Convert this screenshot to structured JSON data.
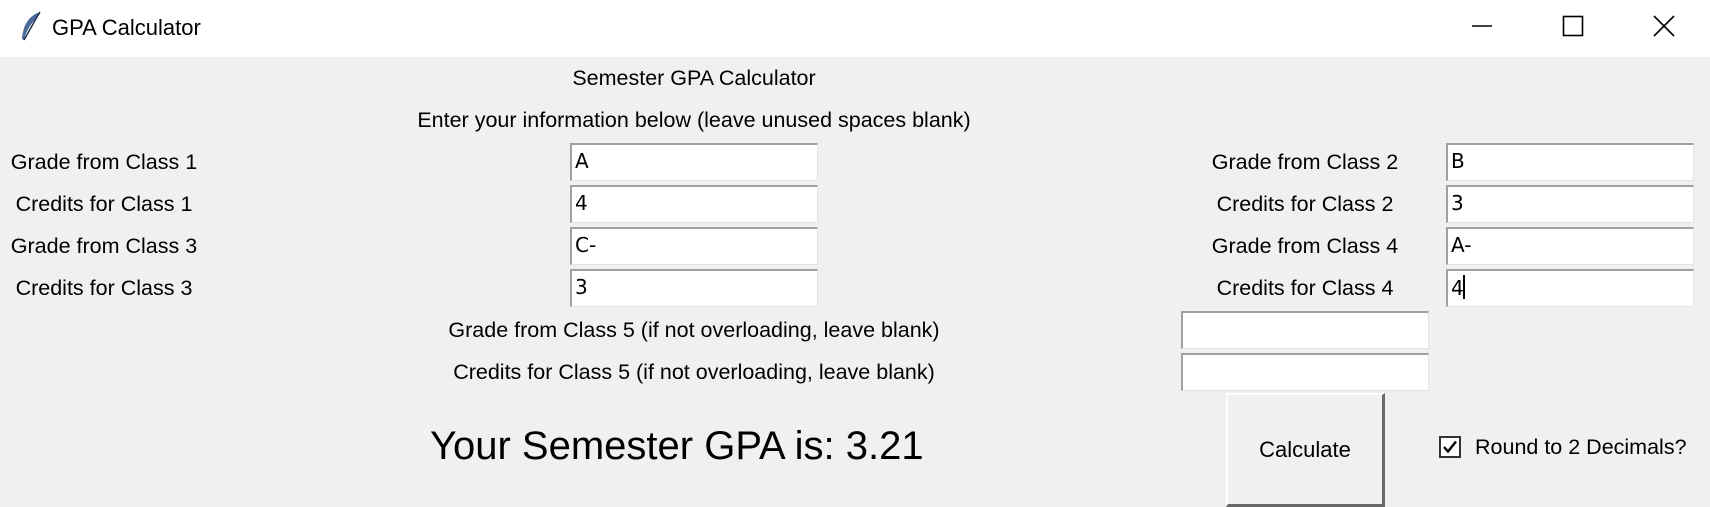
{
  "window": {
    "title": "GPA Calculator",
    "icon": "feather-icon",
    "controls": [
      "minimize-icon",
      "maximize-icon",
      "close-icon"
    ]
  },
  "header": {
    "title": "Semester GPA Calculator",
    "instructions": "Enter your information below (leave unused spaces blank)"
  },
  "fields": {
    "grade1": {
      "label": "Grade from Class 1",
      "value": "A"
    },
    "credits1": {
      "label": "Credits for Class 1",
      "value": "4"
    },
    "grade2": {
      "label": "Grade from Class 2",
      "value": "B"
    },
    "credits2": {
      "label": "Credits for Class 2",
      "value": "3"
    },
    "grade3": {
      "label": "Grade from Class 3",
      "value": "C-"
    },
    "credits3": {
      "label": "Credits for Class 3",
      "value": "3"
    },
    "grade4": {
      "label": "Grade from Class 4",
      "value": "A-"
    },
    "credits4": {
      "label": "Credits for Class 4",
      "value": "4"
    },
    "grade5": {
      "label": "Grade from Class 5 (if not overloading, leave blank)",
      "value": ""
    },
    "credits5": {
      "label": "Credits for Class 5 (if not overloading, leave blank)",
      "value": ""
    }
  },
  "result": {
    "text": "Your Semester GPA is: 3.21"
  },
  "actions": {
    "calculate_label": "Calculate"
  },
  "options": {
    "round_label": "Round to 2 Decimals?",
    "round_checked": true
  }
}
